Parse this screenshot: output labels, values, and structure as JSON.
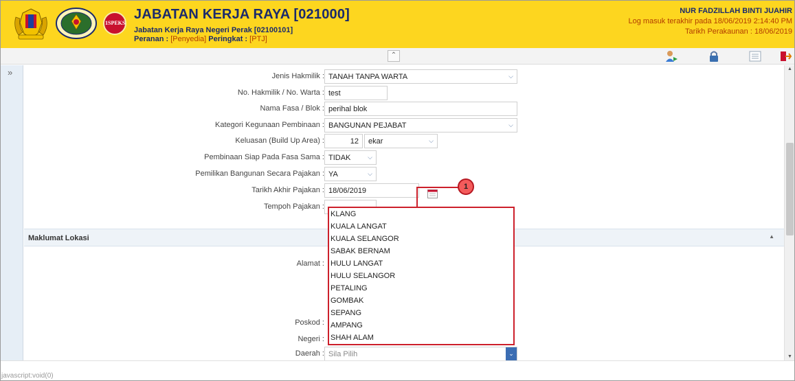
{
  "header": {
    "logo_badge": "1SPEKS",
    "title": "JABATAN KERJA RAYA [021000]",
    "subtitle": "Jabatan Kerja Raya Negeri Perak [02100101]",
    "role_label": "Peranan :",
    "role_value": "[Penyedia]",
    "level_label": "Peringkat :",
    "level_value": "[PTJ]",
    "user_name": "NUR FADZILLAH BINTI JUAHIR",
    "last_login": "Log masuk terakhir pada 18/06/2019 2:14:40 PM",
    "account_date": "Tarikh Perakaunan : 18/06/2019"
  },
  "form": {
    "jenis_hakmilik": {
      "label": "Jenis Hakmilik :",
      "value": "TANAH TANPA WARTA"
    },
    "no_hakmilik": {
      "label": "No. Hakmilik / No. Warta :",
      "value": "test"
    },
    "nama_fasa": {
      "label": "Nama Fasa / Blok :",
      "value": "perihal blok"
    },
    "kategori": {
      "label": "Kategori Kegunaan Pembinaan :",
      "value": "BANGUNAN PEJABAT"
    },
    "keluasan": {
      "label": "Keluasan (Build Up Area) :",
      "value": "12",
      "unit": "ekar"
    },
    "pembinaan_siap": {
      "label": "Pembinaan Siap Pada Fasa Sama :",
      "value": "TIDAK"
    },
    "pemilikan": {
      "label": "Pemilikan Bangunan Secara Pajakan :",
      "value": "YA"
    },
    "tarikh_akhir": {
      "label": "Tarikh Akhir Pajakan :",
      "value": "18/06/2019"
    },
    "tempoh": {
      "label": "Tempoh Pajakan :"
    }
  },
  "section_lokasi": {
    "title": "Maklumat Lokasi",
    "alamat_label": "Alamat :",
    "poskod_label": "Poskod :",
    "negeri_label": "Negeri :",
    "daerah_label": "Daerah :",
    "daerah_value": "Sila Pilih"
  },
  "dropdown_options": [
    "KLANG",
    "KUALA LANGAT",
    "KUALA SELANGOR",
    "SABAK BERNAM",
    "HULU LANGAT",
    "HULU SELANGOR",
    "PETALING",
    "GOMBAK",
    "SEPANG",
    "AMPANG",
    "SHAH ALAM"
  ],
  "callout_number": "1",
  "status_bar": "javascript:void(0)",
  "colors": {
    "header_bg": "#fdd61f",
    "title": "#1a2a6c",
    "accent_red": "#cc1f2a"
  }
}
